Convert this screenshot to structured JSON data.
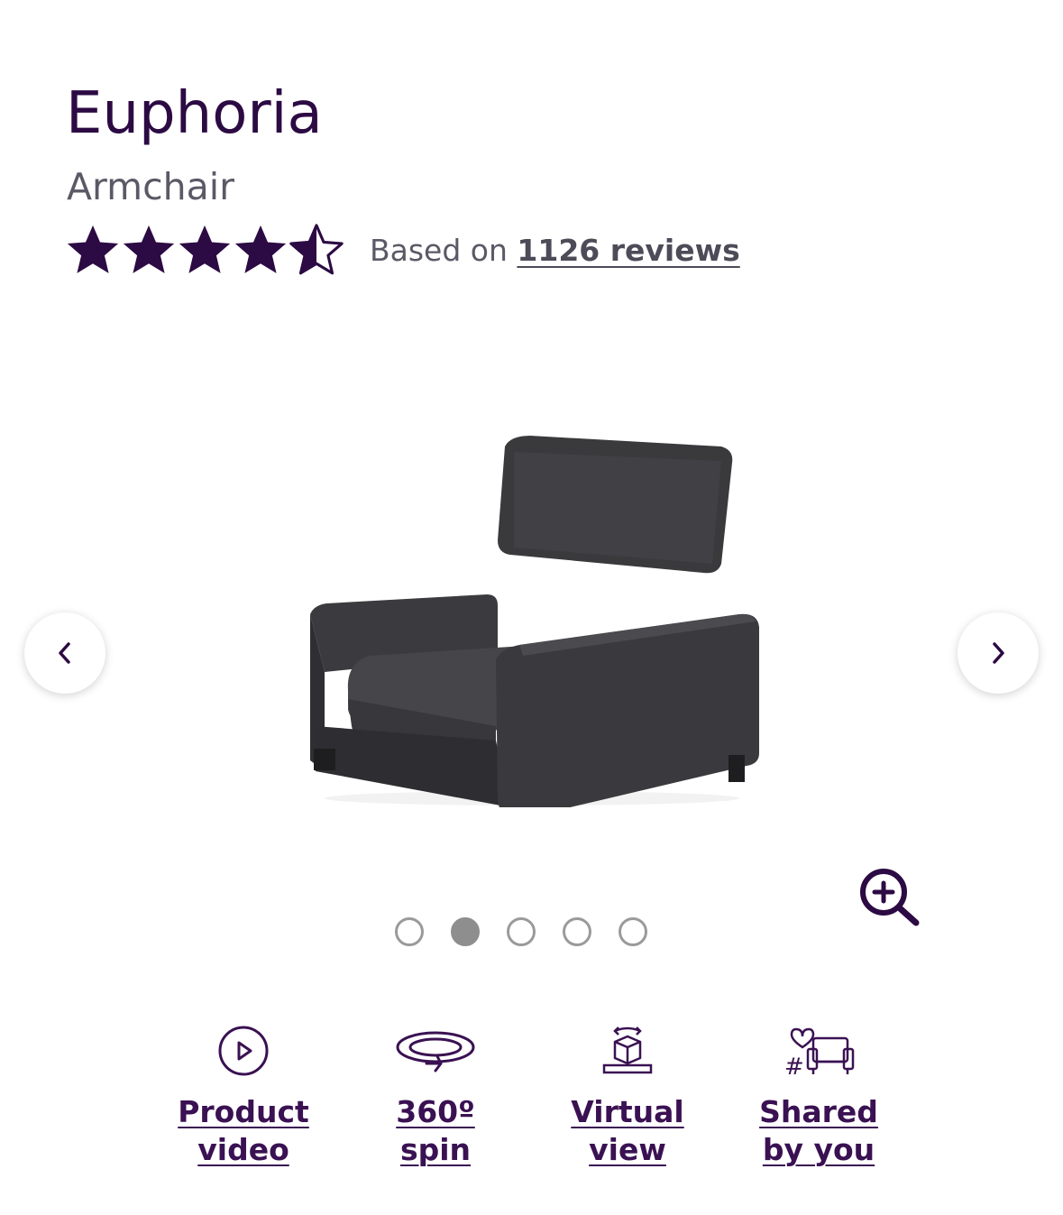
{
  "product": {
    "name": "Euphoria",
    "type": "Armchair"
  },
  "rating": {
    "stars": 4.5,
    "max_stars": 5,
    "prefix": "Based on",
    "reviews_link": "1126 reviews"
  },
  "gallery": {
    "image_alt": "Dark grey armchair",
    "dots_count": 5,
    "active_index": 1
  },
  "features": [
    {
      "label_line1": "Product",
      "label_line2": "video",
      "icon": "play-icon"
    },
    {
      "label_line1": "360º",
      "label_line2": "spin",
      "icon": "rotate-360-icon"
    },
    {
      "label_line1": "Virtual",
      "label_line2": "view",
      "icon": "ar-cube-icon"
    },
    {
      "label_line1": "Shared",
      "label_line2": "by you",
      "icon": "shared-sofa-icon"
    }
  ],
  "colors": {
    "brand": "#2c0a43",
    "subtitle": "#5b5966",
    "link": "#3a1152"
  }
}
